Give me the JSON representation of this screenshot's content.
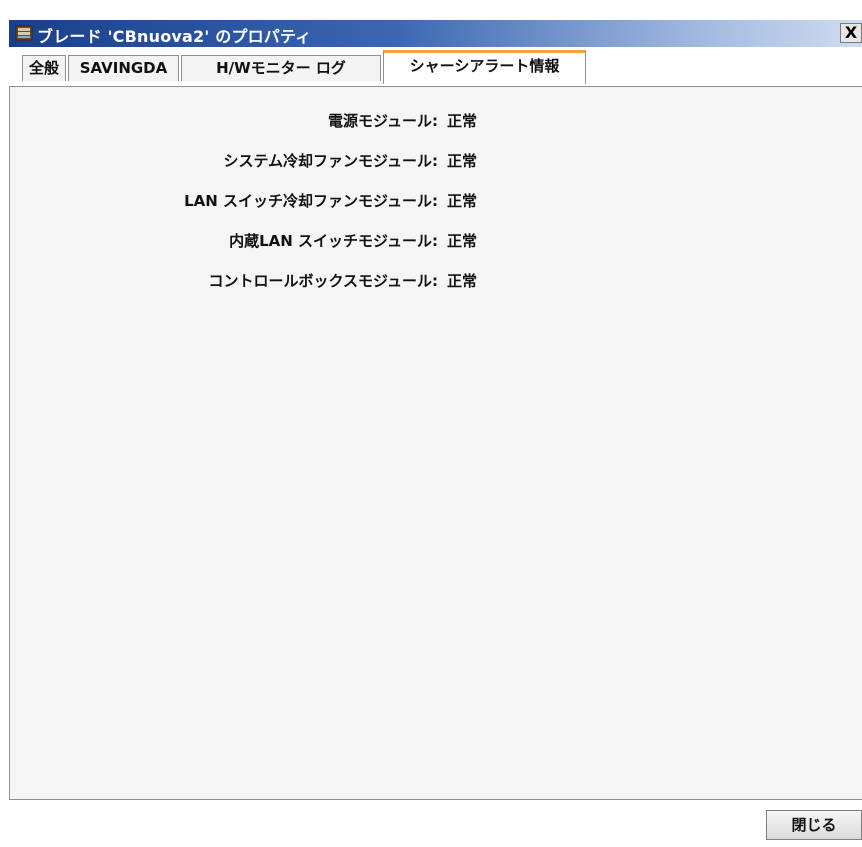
{
  "window": {
    "title": "ブレード 'CBnuova2' のプロパティ",
    "close_glyph": "X",
    "icon": "server-chassis-icon"
  },
  "tabs": [
    {
      "label": "全般",
      "active": false
    },
    {
      "label": "SAVINGDA",
      "active": false
    },
    {
      "label": "H/Wモニター ログ",
      "active": false
    },
    {
      "label": "シャーシアラート情報",
      "active": true
    }
  ],
  "alerts": [
    {
      "label": "電源モジュール:",
      "value": "正常"
    },
    {
      "label": "システム冷却ファンモジュール:",
      "value": "正常"
    },
    {
      "label": "LAN スイッチ冷却ファンモジュール:",
      "value": "正常"
    },
    {
      "label": "内蔵LAN スイッチモジュール:",
      "value": "正常"
    },
    {
      "label": "コントロールボックスモジュール:",
      "value": "正常"
    }
  ],
  "footer": {
    "close_button_label": "閉じる"
  },
  "colors": {
    "active_tab_accent": "#f3a23a",
    "titlebar_start": "#1a3f8a",
    "titlebar_end": "#cfdcf0"
  }
}
